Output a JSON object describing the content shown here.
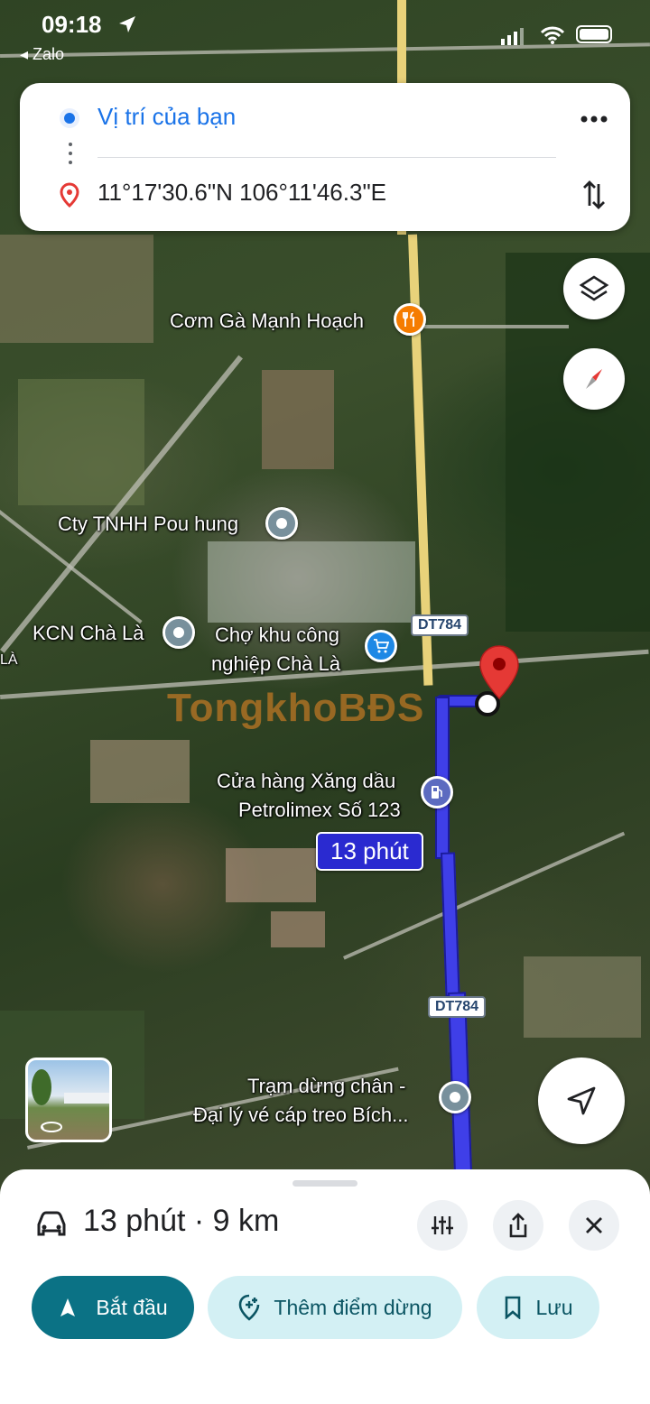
{
  "status_bar": {
    "time": "09:18",
    "back_app": "Zalo"
  },
  "directions": {
    "origin": "Vị trí của bạn",
    "destination": "11°17'30.6\"N 106°11'46.3\"E"
  },
  "map": {
    "labels": {
      "restaurant": "Cơm Gà Mạnh Hoạch",
      "company": "Cty TNHH Pou hung",
      "industrial_park": "KCN Chà Là",
      "market_line1": "Chợ khu công",
      "market_line2": "nghiệp Chà Là",
      "gas_line1": "Cửa hàng Xăng dầu",
      "gas_line2": "Petrolimex Số 123",
      "stop_line1": "Trạm dừng chân -",
      "stop_line2": "Đại lý vé cáp treo Bích...",
      "edge_fragment": "LÀ"
    },
    "road_shields": [
      "DT784",
      "DT784"
    ],
    "route_badge": "13 phút",
    "watermark": "TongkhoBĐS",
    "route_color": "#3f3fe8"
  },
  "sheet": {
    "summary": "13 phút · 9 km",
    "start_label": "Bắt đầu",
    "add_stop_label": "Thêm điểm dừng",
    "save_label": "Lưu"
  },
  "icons": {
    "origin": "blue-dot-icon",
    "destination": "red-pin-icon",
    "more": "more-horizontal-icon",
    "swap": "swap-vertical-icon",
    "layers": "layers-icon",
    "compass": "compass-icon",
    "recenter": "navigation-arrow-icon",
    "car": "car-icon",
    "options": "tune-icon",
    "share": "share-icon",
    "close": "close-icon"
  },
  "colors": {
    "accent_blue": "#1a73e8",
    "start_button": "#0b7285",
    "pill_bg": "#d3f0f4",
    "pin_red": "#e53935"
  }
}
